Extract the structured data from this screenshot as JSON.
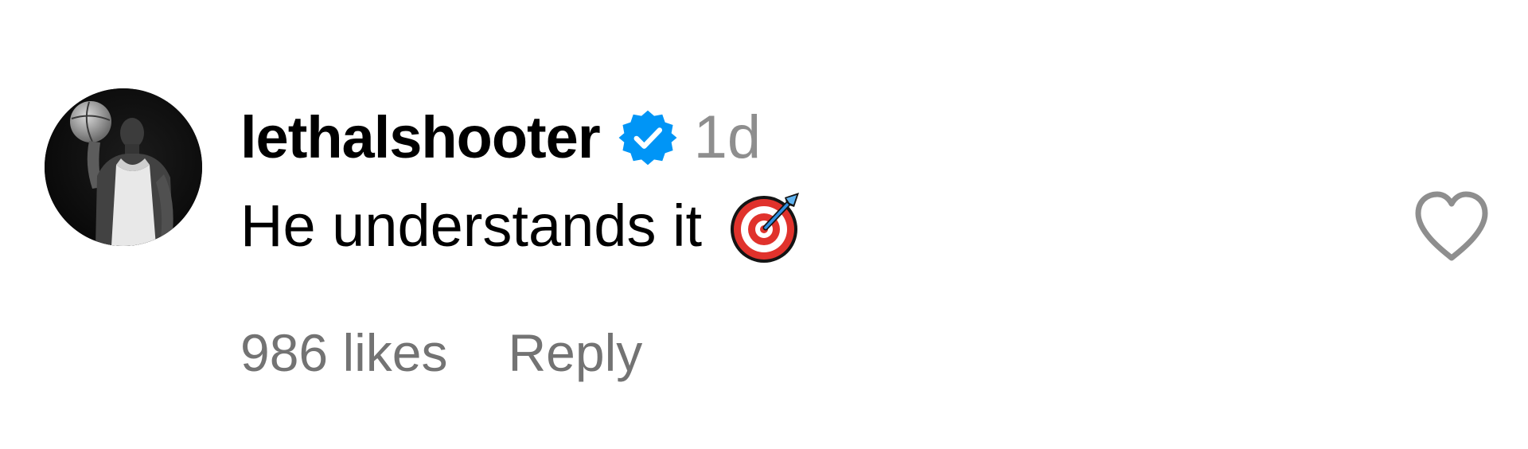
{
  "comment": {
    "username": "lethalshooter",
    "verified": true,
    "time_ago": "1d",
    "text": "He understands it",
    "emoji": "direct-hit-emoji",
    "likes_text": "986 likes",
    "reply_label": "Reply",
    "like_icon": "heart-outline-icon"
  },
  "colors": {
    "verified_badge": "#0095f6",
    "secondary_text": "#737373",
    "timestamp": "#8e8e8e",
    "heart_outline": "#8e8e8e"
  }
}
